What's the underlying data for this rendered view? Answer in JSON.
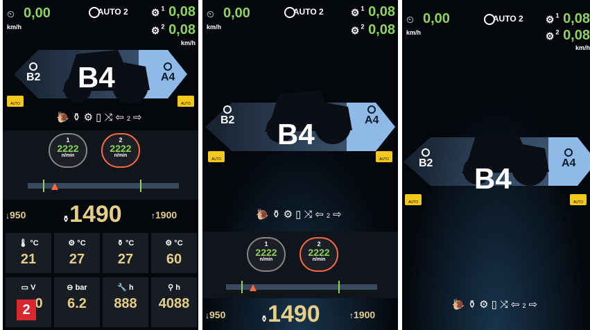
{
  "speed": {
    "value": "0,00",
    "unit": "km/h"
  },
  "slip": {
    "row1_label": "1",
    "row1_value": "0,08",
    "row2_label": "2",
    "row2_value": "0,08",
    "unit": "km/h"
  },
  "auto_mode": "AUTO 2",
  "gears": {
    "left": "B2",
    "center": "B4",
    "right": "A4"
  },
  "badges": {
    "left": "AUTO",
    "right": "AUTO"
  },
  "function_icons": [
    "snail-icon",
    "tank-icon",
    "pto-icon",
    "book-icon",
    "shuttle-icon",
    "2wd-icon"
  ],
  "two_wd_label": "2",
  "rpm_memory": [
    {
      "id": "1",
      "value": "2222",
      "unit": "n/min"
    },
    {
      "id": "2",
      "value": "2222",
      "unit": "n/min"
    }
  ],
  "rpm": {
    "min": "950",
    "current": "1490",
    "max": "1900",
    "unit": "n/min"
  },
  "temperatures": [
    {
      "label": "°C",
      "value": "21",
      "icon": "coolant-icon"
    },
    {
      "label": "°C",
      "value": "27",
      "icon": "transmission-oil-icon"
    },
    {
      "label": "°C",
      "value": "27",
      "icon": "engine-oil-icon"
    },
    {
      "label": "°C",
      "value": "60",
      "icon": "hst-icon"
    }
  ],
  "readings": [
    {
      "label": "V",
      "value": "0",
      "icon": "battery-icon"
    },
    {
      "label": "bar",
      "value": "6.2",
      "icon": "pressure-icon"
    },
    {
      "label": "h",
      "value": "888",
      "icon": "wrench-icon"
    },
    {
      "label": "h",
      "value": "4088",
      "icon": "tractor-hours-icon"
    }
  ],
  "figure_number": "2",
  "colors": {
    "accent_green": "#8ed35b",
    "rpm_gold": "#e4cf8a",
    "orange": "#ff6a3d",
    "badge_yellow": "#f2c81c",
    "figure_red": "#d7272f"
  }
}
